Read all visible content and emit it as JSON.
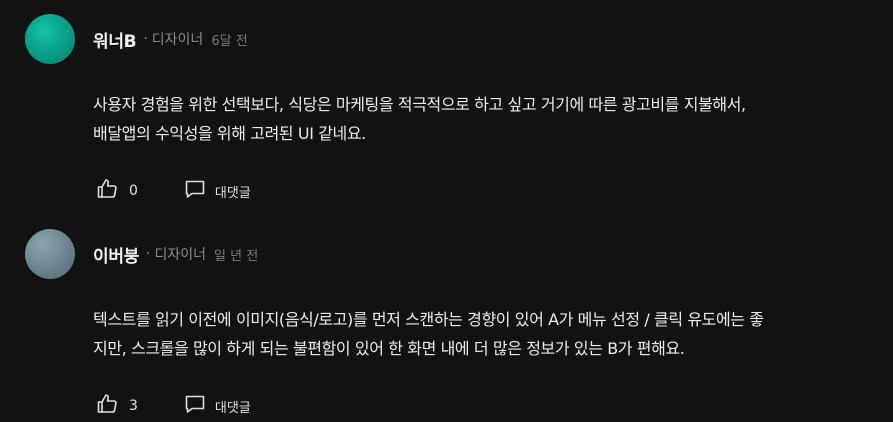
{
  "comments": [
    {
      "author": "워너B",
      "separator": "·",
      "role": "디자이너",
      "time": "6달 전",
      "text": "사용자 경험을 위한 선택보다, 식당은 마케팅을 적극적으로 하고 싶고 거기에 따른 광고비를 지불해서,\n배달앱의 수익성을 위해 고려된 UI  같네요.",
      "likes": "0",
      "reply_label": "대댓글"
    },
    {
      "author": "이버붕",
      "separator": "·",
      "role": "디자이너",
      "time": "일 년 전",
      "text": "텍스트를 읽기 이전에 이미지(음식/로고)를 먼저 스캔하는 경향이 있어 A가 메뉴 선정 / 클릭 유도에는 좋\n지만, 스크롤을 많이 하게 되는 불편함이 있어 한 화면 내에 더 많은 정보가 있는 B가 편해요.",
      "likes": "3",
      "reply_label": "대댓글"
    }
  ],
  "icons": {
    "like": "thumbs-up-icon",
    "reply": "speech-bubble-icon"
  }
}
